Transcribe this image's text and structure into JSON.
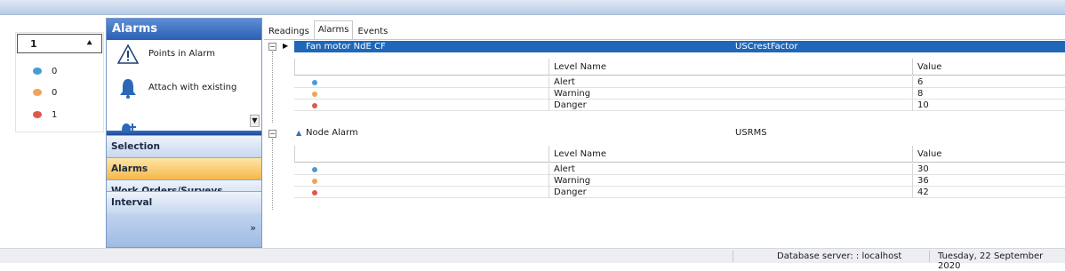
{
  "summary": {
    "selector_value": "1",
    "counts": [
      {
        "color": "#4a9bd5",
        "value": "0"
      },
      {
        "color": "#f0a35a",
        "value": "0"
      },
      {
        "color": "#e0574f",
        "value": "1"
      }
    ]
  },
  "nav": {
    "header": "Alarms",
    "items": [
      {
        "label": "Points in Alarm",
        "icon": "warning-triangle-icon"
      },
      {
        "label": "Attach with existing",
        "icon": "bell-icon"
      }
    ],
    "buttons": [
      "Selection",
      "Alarms",
      "Work Orders/Surveys",
      "Interval"
    ],
    "active": "Alarms"
  },
  "tabs": [
    "Readings",
    "Alarms",
    "Events"
  ],
  "active_tab": "Alarms",
  "grid": {
    "columns": {
      "level_name": "Level Name",
      "value": "Value"
    },
    "groups": [
      {
        "name": "Fan motor NdE CF",
        "type": "USCrestFactor",
        "selected": true,
        "levels": [
          {
            "color": "#4a9bd5",
            "name": "Alert",
            "value": "6"
          },
          {
            "color": "#f0a35a",
            "name": "Warning",
            "value": "8"
          },
          {
            "color": "#e0574f",
            "name": "Danger",
            "value": "10"
          }
        ]
      },
      {
        "name": "Node Alarm",
        "type": "USRMS",
        "selected": false,
        "levels": [
          {
            "color": "#4a9bd5",
            "name": "Alert",
            "value": "30"
          },
          {
            "color": "#f0a35a",
            "name": "Warning",
            "value": "36"
          },
          {
            "color": "#e0574f",
            "name": "Danger",
            "value": "42"
          }
        ]
      }
    ]
  },
  "status": {
    "server": "Database server: : localhost",
    "date": "Tuesday, 22 September 2020"
  }
}
